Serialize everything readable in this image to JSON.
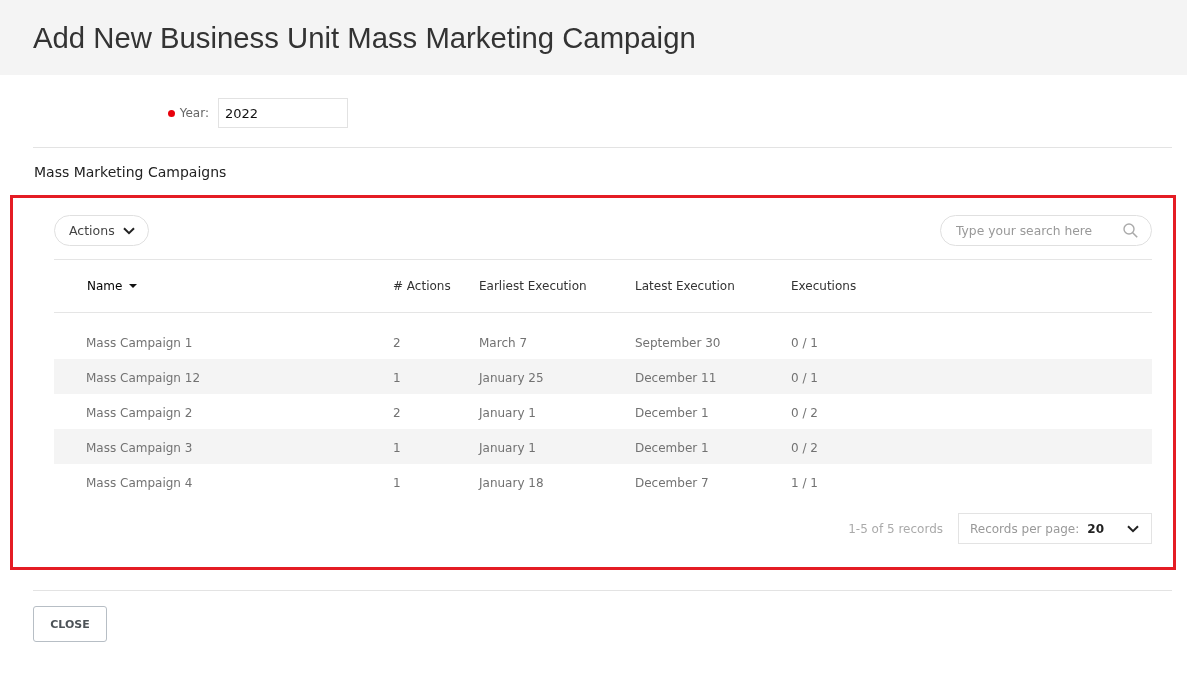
{
  "header": {
    "title": "Add New Business Unit Mass Marketing Campaign"
  },
  "form": {
    "fields": [
      {
        "label": "Year:",
        "value": "2022",
        "required": true
      }
    ]
  },
  "section": {
    "title": "Mass Marketing Campaigns"
  },
  "table_panel": {
    "highlighted": true,
    "actions_button": "Actions",
    "search": {
      "placeholder": "Type your search here"
    },
    "columns": [
      {
        "label": "Name",
        "sorted": true
      },
      {
        "label": "# Actions",
        "sorted": false
      },
      {
        "label": "Earliest Execution",
        "sorted": false
      },
      {
        "label": "Latest Execution",
        "sorted": false
      },
      {
        "label": "Executions",
        "sorted": false
      }
    ],
    "rows": [
      {
        "cells": [
          "Mass Campaign 1",
          "2",
          "March 7",
          "September 30",
          "0 / 1"
        ]
      },
      {
        "cells": [
          "Mass Campaign 12",
          "1",
          "January 25",
          "December 11",
          "0 / 1"
        ]
      },
      {
        "cells": [
          "Mass Campaign 2",
          "2",
          "January 1",
          "December 1",
          "0 / 2"
        ]
      },
      {
        "cells": [
          "Mass Campaign 3",
          "1",
          "January 1",
          "December 1",
          "0 / 2"
        ]
      },
      {
        "cells": [
          "Mass Campaign 4",
          "1",
          "January 18",
          "December 7",
          "1 / 1"
        ]
      }
    ],
    "footer": {
      "record_count": "1-5 of 5 records",
      "page_size_label": "Records per page:",
      "page_size_value": "20"
    }
  },
  "buttons": [
    {
      "label": "CLOSE"
    }
  ]
}
